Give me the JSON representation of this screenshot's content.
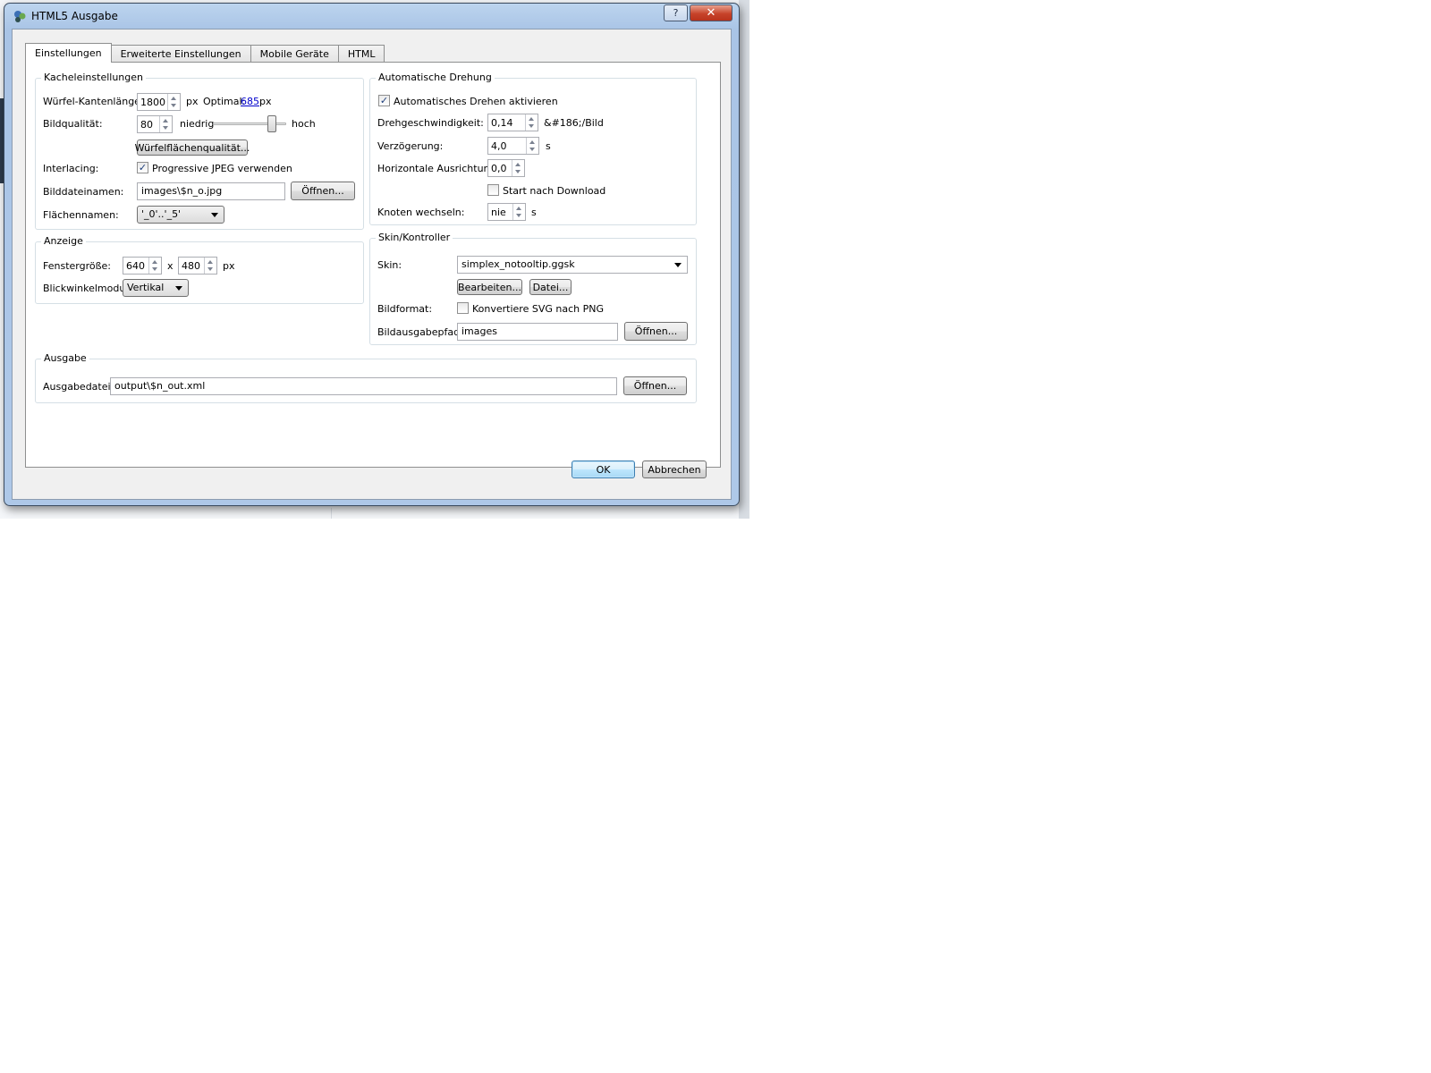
{
  "window": {
    "title": "HTML5 Ausgabe",
    "help_label": "?",
    "close_label": "✕"
  },
  "tabs": [
    {
      "label": "Einstellungen"
    },
    {
      "label": "Erweiterte Einstellungen"
    },
    {
      "label": "Mobile Geräte"
    },
    {
      "label": "HTML"
    }
  ],
  "kachel": {
    "title": "Kacheleinstellungen",
    "cube_label": "Würfel-Kantenlänge:",
    "cube_value": "1800",
    "cube_unit": "px",
    "optimal_label": "Optimal:",
    "optimal_value": "685",
    "optimal_unit": "px",
    "quality_label": "Bildqualität:",
    "quality_value": "80",
    "low_label": "niedrig",
    "high_label": "hoch",
    "quality_slider_level": 0.85,
    "face_quality_button": "Würfelflächenqualität...",
    "interlacing_label": "Interlacing:",
    "progressive_label": "Progressive JPEG verwenden",
    "progressive_checked": true,
    "filenames_label": "Bilddateinamen:",
    "filenames_value": "images\\$n_o.jpg",
    "open_button": "Öffnen...",
    "facenames_label": "Flächennamen:",
    "facenames_value": "'_0'..'_5'"
  },
  "anzeige": {
    "title": "Anzeige",
    "window_size_label": "Fenstergröße:",
    "width_value": "640",
    "x_label": "x",
    "height_value": "480",
    "unit": "px",
    "view_mode_label": "Blickwinkelmodus:",
    "view_mode_value": "Vertikal"
  },
  "drehung": {
    "title": "Automatische Drehung",
    "enable_label": "Automatisches Drehen aktivieren",
    "enable_checked": true,
    "speed_label": "Drehgeschwindigkeit:",
    "speed_value": "0,14",
    "speed_unit": "&#186;/Bild",
    "delay_label": "Verzögerung:",
    "delay_value": "4,0",
    "delay_unit": "s",
    "horizon_label": "Horizontale Ausrichtung:",
    "horizon_value": "0,0",
    "start_label": "Start nach Download",
    "start_checked": false,
    "node_label": "Knoten wechseln:",
    "node_value": "nie",
    "node_unit": "s"
  },
  "skin": {
    "title": "Skin/Kontroller",
    "skin_label": "Skin:",
    "skin_value": "simplex_notooltip.ggsk",
    "edit_button": "Bearbeiten...",
    "file_button": "Datei...",
    "format_label": "Bildformat:",
    "convert_label": "Konvertiere SVG nach PNG",
    "convert_checked": false,
    "path_label": "Bildausgabepfad:",
    "path_value": "images",
    "open_button": "Öffnen..."
  },
  "ausgabe": {
    "title": "Ausgabe",
    "file_label": "Ausgabedatei:",
    "file_value": "output\\$n_out.xml",
    "open_button": "Öffnen..."
  },
  "footer": {
    "ok_label": "OK",
    "cancel_label": "Abbrechen"
  }
}
